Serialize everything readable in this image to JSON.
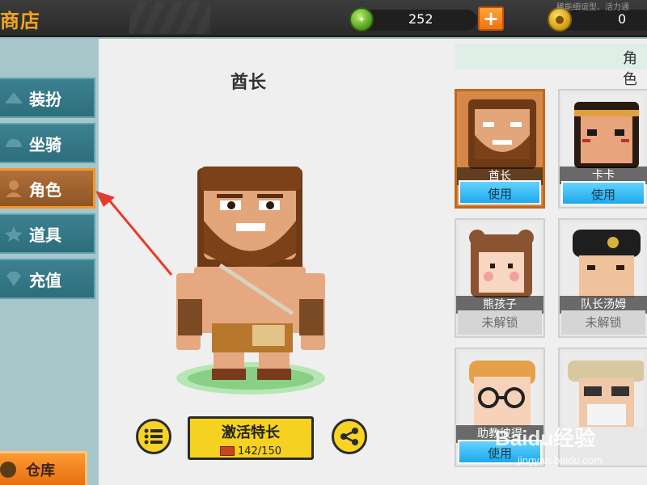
{
  "topbar": {
    "title": "商店",
    "gems": "252",
    "plus_label": "+",
    "coins": "0",
    "hint": "稀能细谊型、活力通"
  },
  "sidebar": {
    "items": [
      {
        "label": "装扮",
        "icon": "hanger-icon",
        "active": false
      },
      {
        "label": "坐骑",
        "icon": "mount-icon",
        "active": false
      },
      {
        "label": "角色",
        "icon": "character-icon",
        "active": true
      },
      {
        "label": "道具",
        "icon": "item-icon",
        "active": false
      },
      {
        "label": "充值",
        "icon": "gem-icon",
        "active": false
      }
    ],
    "warehouse_label": "仓库"
  },
  "character": {
    "name": "酋长",
    "activate_label": "激活特长",
    "activate_progress": "142/150"
  },
  "roles": {
    "header": "角色",
    "cards": [
      {
        "name": "酋长",
        "button": "使用",
        "locked": false,
        "selected": true
      },
      {
        "name": "卡卡",
        "button": "使用",
        "locked": false,
        "selected": false
      },
      {
        "name": "熊孩子",
        "button": "未解锁",
        "locked": true,
        "selected": false
      },
      {
        "name": "队长汤姆",
        "button": "未解锁",
        "locked": true,
        "selected": false
      },
      {
        "name": "助教彼得",
        "button": "使用",
        "locked": false,
        "selected": false
      },
      {
        "name": "",
        "button": "",
        "locked": false,
        "selected": false
      }
    ]
  },
  "watermark": {
    "main": "Baidu经验",
    "sub": "jingyan.baidu.com"
  },
  "colors": {
    "accent_orange": "#f3982b",
    "nav_teal": "#2e6e7c",
    "use_blue": "#1ea9ec",
    "yellow_button": "#f5d21f"
  }
}
